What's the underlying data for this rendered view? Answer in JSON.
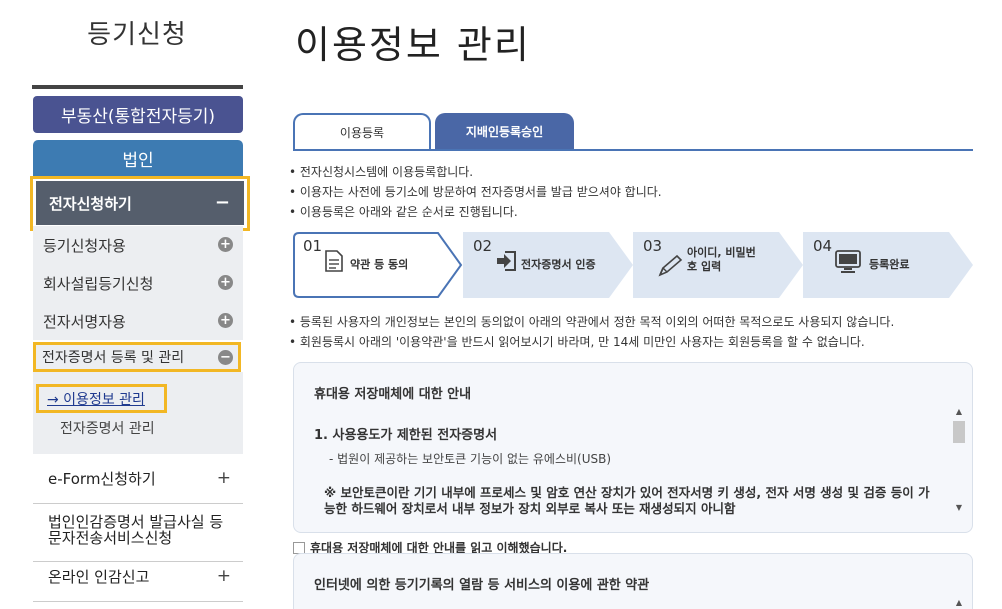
{
  "sidebar": {
    "title": "등기신청",
    "btn_realestate": "부동산(통합전자등기)",
    "btn_corp": "법인",
    "active_item": "전자신청하기",
    "active_toggle": "−",
    "sub_items": [
      {
        "label": "등기신청자용",
        "icon": "+"
      },
      {
        "label": "회사설립등기신청",
        "icon": "+"
      },
      {
        "label": "전자서명자용",
        "icon": "+"
      },
      {
        "label": "전자증명서 등록 및 관리",
        "icon": "−"
      }
    ],
    "link_current": "→ 이용정보 관리",
    "link_other": "전자증명서 관리",
    "items": [
      {
        "label": "e-Form신청하기",
        "icon": "+"
      },
      {
        "label": "법인인감증명서 발급사실 등문자전송서비스신청",
        "icon": ""
      },
      {
        "label": "온라인 인감신고",
        "icon": "+"
      }
    ]
  },
  "main": {
    "title": "이용정보 관리",
    "tabs": [
      {
        "label": "이용등록",
        "active": true
      },
      {
        "label": "지배인등록승인",
        "active": false
      }
    ],
    "intro": [
      "• 전자신청시스템에 이용등록합니다.",
      "• 이용자는 사전에 등기소에 방문하여 전자증명서를 발급 받으셔야 합니다.",
      "• 이용등록은 아래와 같은 순서로 진행됩니다."
    ],
    "steps": [
      {
        "num": "01",
        "label": "약관 등 동의",
        "icon": "document-icon"
      },
      {
        "num": "02",
        "label": "전자증명서 인증",
        "icon": "arrow-login-icon"
      },
      {
        "num": "03",
        "label": "아이디, 비밀번호 입력",
        "label_l1": "아이디, 비밀번",
        "label_l2": "호 입력",
        "icon": "pencil-icon"
      },
      {
        "num": "04",
        "label": "등록완료",
        "icon": "monitor-icon"
      }
    ],
    "notes": [
      "• 등록된 사용자의 개인정보는 본인의 동의없이 아래의 약관에서 정한 목적 이외의 어떠한 목적으로도 사용되지 않습니다.",
      "• 회원등록시 아래의 '이용약관'을 반드시 읽어보시기 바라며, 만 14세 미만인 사용자는 회원등록을 할 수 없습니다."
    ],
    "box1": {
      "heading": "휴대용 저장매체에 대한 안내",
      "section": "1. 사용용도가 제한된 전자증명서",
      "para": "- 법원이 제공하는 보안토큰 기능이 없는 유에스비(USB)",
      "note": "※ 보안토큰이란 기기 내부에 프로세스 및 암호 연산 장치가 있어 전자서명 키 생성, 전자 서명 생성 및 검증 등이 가능한 하드웨어 장치로서 내부 정보가 장치 외부로 복사 또는 재생성되지 아니함"
    },
    "agree_label": "휴대용 저장매체에 대한 안내를 읽고 이해했습니다.",
    "box2": {
      "heading": "인터넷에 의한 등기기록의 열람 등 서비스의 이용에 관한 약관"
    }
  },
  "colors": {
    "accent_blue": "#4a67a6",
    "highlight": "#f2b724",
    "active_step": "#4a74b5",
    "step_bg": "#dde6f2"
  }
}
